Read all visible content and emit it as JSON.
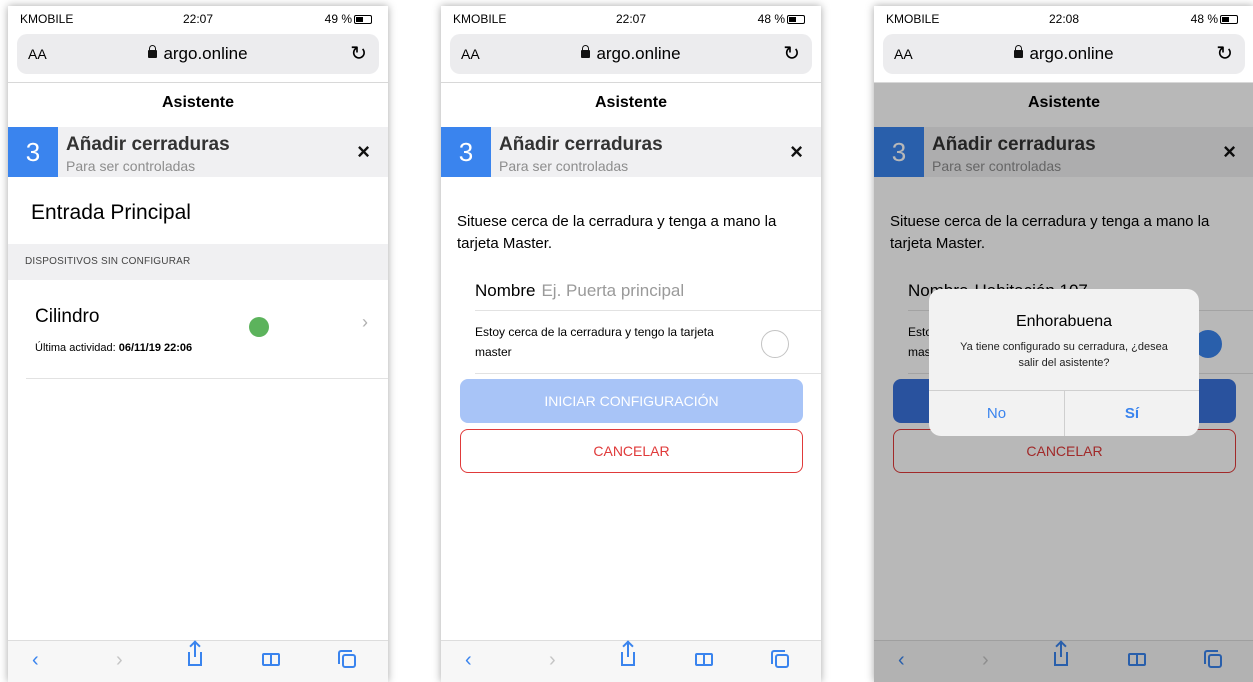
{
  "status": {
    "carrier": "KMOBILE",
    "screens": [
      {
        "time": "22:07",
        "battery": "49 %"
      },
      {
        "time": "22:07",
        "battery": "48 %"
      },
      {
        "time": "22:08",
        "battery": "48 %"
      }
    ]
  },
  "browser": {
    "text_size_label": "AA",
    "url": "argo.online"
  },
  "app": {
    "header_title": "Asistente",
    "step_number": "3",
    "step_title": "Añadir cerraduras",
    "step_subtitle": "Para ser controladas",
    "close_glyph": "×"
  },
  "screen1": {
    "location_name": "Entrada Principal",
    "section_header": "DISPOSITIVOS SIN CONFIGURAR",
    "device": {
      "name": "Cilindro",
      "activity_label": "Última actividad:",
      "activity_value": "06/11/19 22:06",
      "status_color": "#5cb35c"
    }
  },
  "form": {
    "instructions": "Situese cerca de la cerradura y tenga a mano la tarjeta Master.",
    "name_label": "Nombre",
    "name_placeholder": "Ej. Puerta principal",
    "name_value_screen3": "Habitación 107",
    "check_text": "Estoy cerca de la cerradura y tengo la tarjeta master",
    "start_button": "INICIAR CONFIGURACIÓN",
    "cancel_button": "CANCELAR"
  },
  "dialog": {
    "title": "Enhorabuena",
    "message": "Ya tiene configurado su cerradura, ¿desea salir del asistente?",
    "no_label": "No",
    "yes_label": "Sí"
  },
  "colors": {
    "accent": "#3a84ee",
    "danger": "#e03a3a",
    "online": "#5cb35c"
  }
}
